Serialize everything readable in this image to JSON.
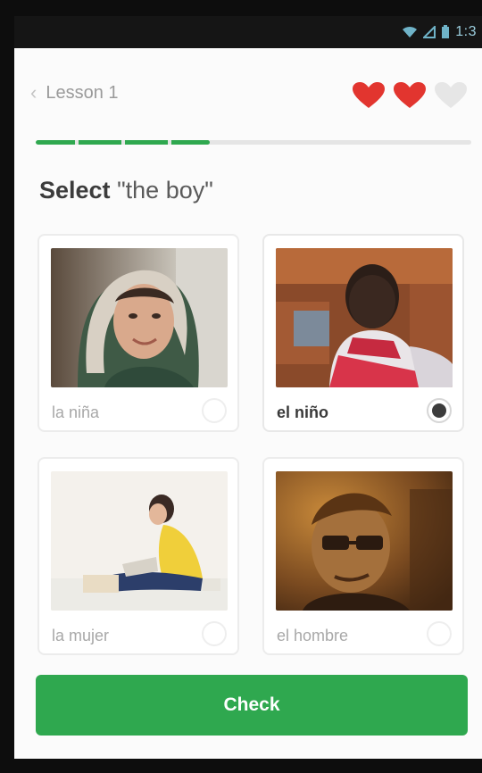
{
  "status_bar": {
    "time": "1:3",
    "icons": [
      "wifi-icon",
      "signal-icon",
      "battery-icon"
    ]
  },
  "header": {
    "back_label": "Lesson 1",
    "hearts_total": 3,
    "hearts_filled": 2
  },
  "progress": {
    "fraction": 0.4
  },
  "prompt": {
    "verb": "Select",
    "word": "\"the boy\""
  },
  "options": [
    {
      "label": "la niña",
      "selected": false,
      "image": "girl-photo"
    },
    {
      "label": "el niño",
      "selected": true,
      "image": "boy-photo"
    },
    {
      "label": "la mujer",
      "selected": false,
      "image": "woman-photo"
    },
    {
      "label": "el hombre",
      "selected": false,
      "image": "man-photo"
    }
  ],
  "footer": {
    "check_label": "Check"
  },
  "colors": {
    "accent_green": "#2fa84f",
    "heart_red": "#e2352f",
    "heart_empty": "#e6e6e6"
  }
}
